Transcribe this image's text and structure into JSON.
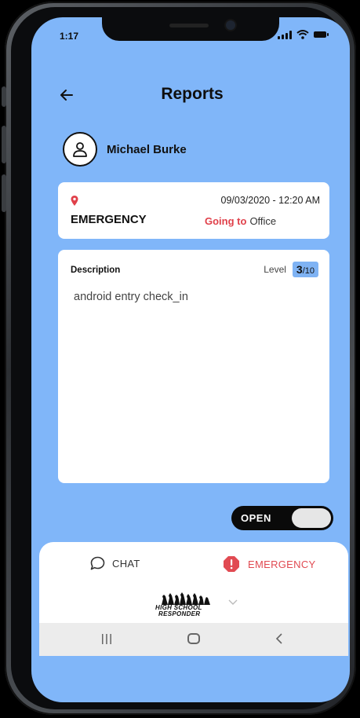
{
  "status_bar": {
    "time": "1:17"
  },
  "header": {
    "title": "Reports",
    "back_icon": "arrow-left-icon"
  },
  "user": {
    "name": "Michael Burke",
    "avatar_icon": "user-icon"
  },
  "incident": {
    "location_icon": "map-pin-icon",
    "datetime": "09/03/2020 - 12:20 AM",
    "type": "EMERGENCY",
    "going_label": "Going to",
    "destination": "Office"
  },
  "description": {
    "title": "Description",
    "level_label": "Level",
    "level_value": "3",
    "level_max": "/10",
    "text": "android entry check_in"
  },
  "status_toggle": {
    "label": "OPEN",
    "on": false
  },
  "bottom_tabs": [
    {
      "label": "CHAT",
      "icon": "chat-bubble-icon"
    },
    {
      "label": "EMERGENCY",
      "icon": "alert-octagon-icon",
      "color": "#e14a52"
    }
  ],
  "logo": {
    "line1": "HIGH SCHOOL",
    "line2": "RESPONDER"
  },
  "colors": {
    "screen_bg": "#80b6f9",
    "accent_red": "#e0404a",
    "level_badge": "#7fb3f4"
  }
}
